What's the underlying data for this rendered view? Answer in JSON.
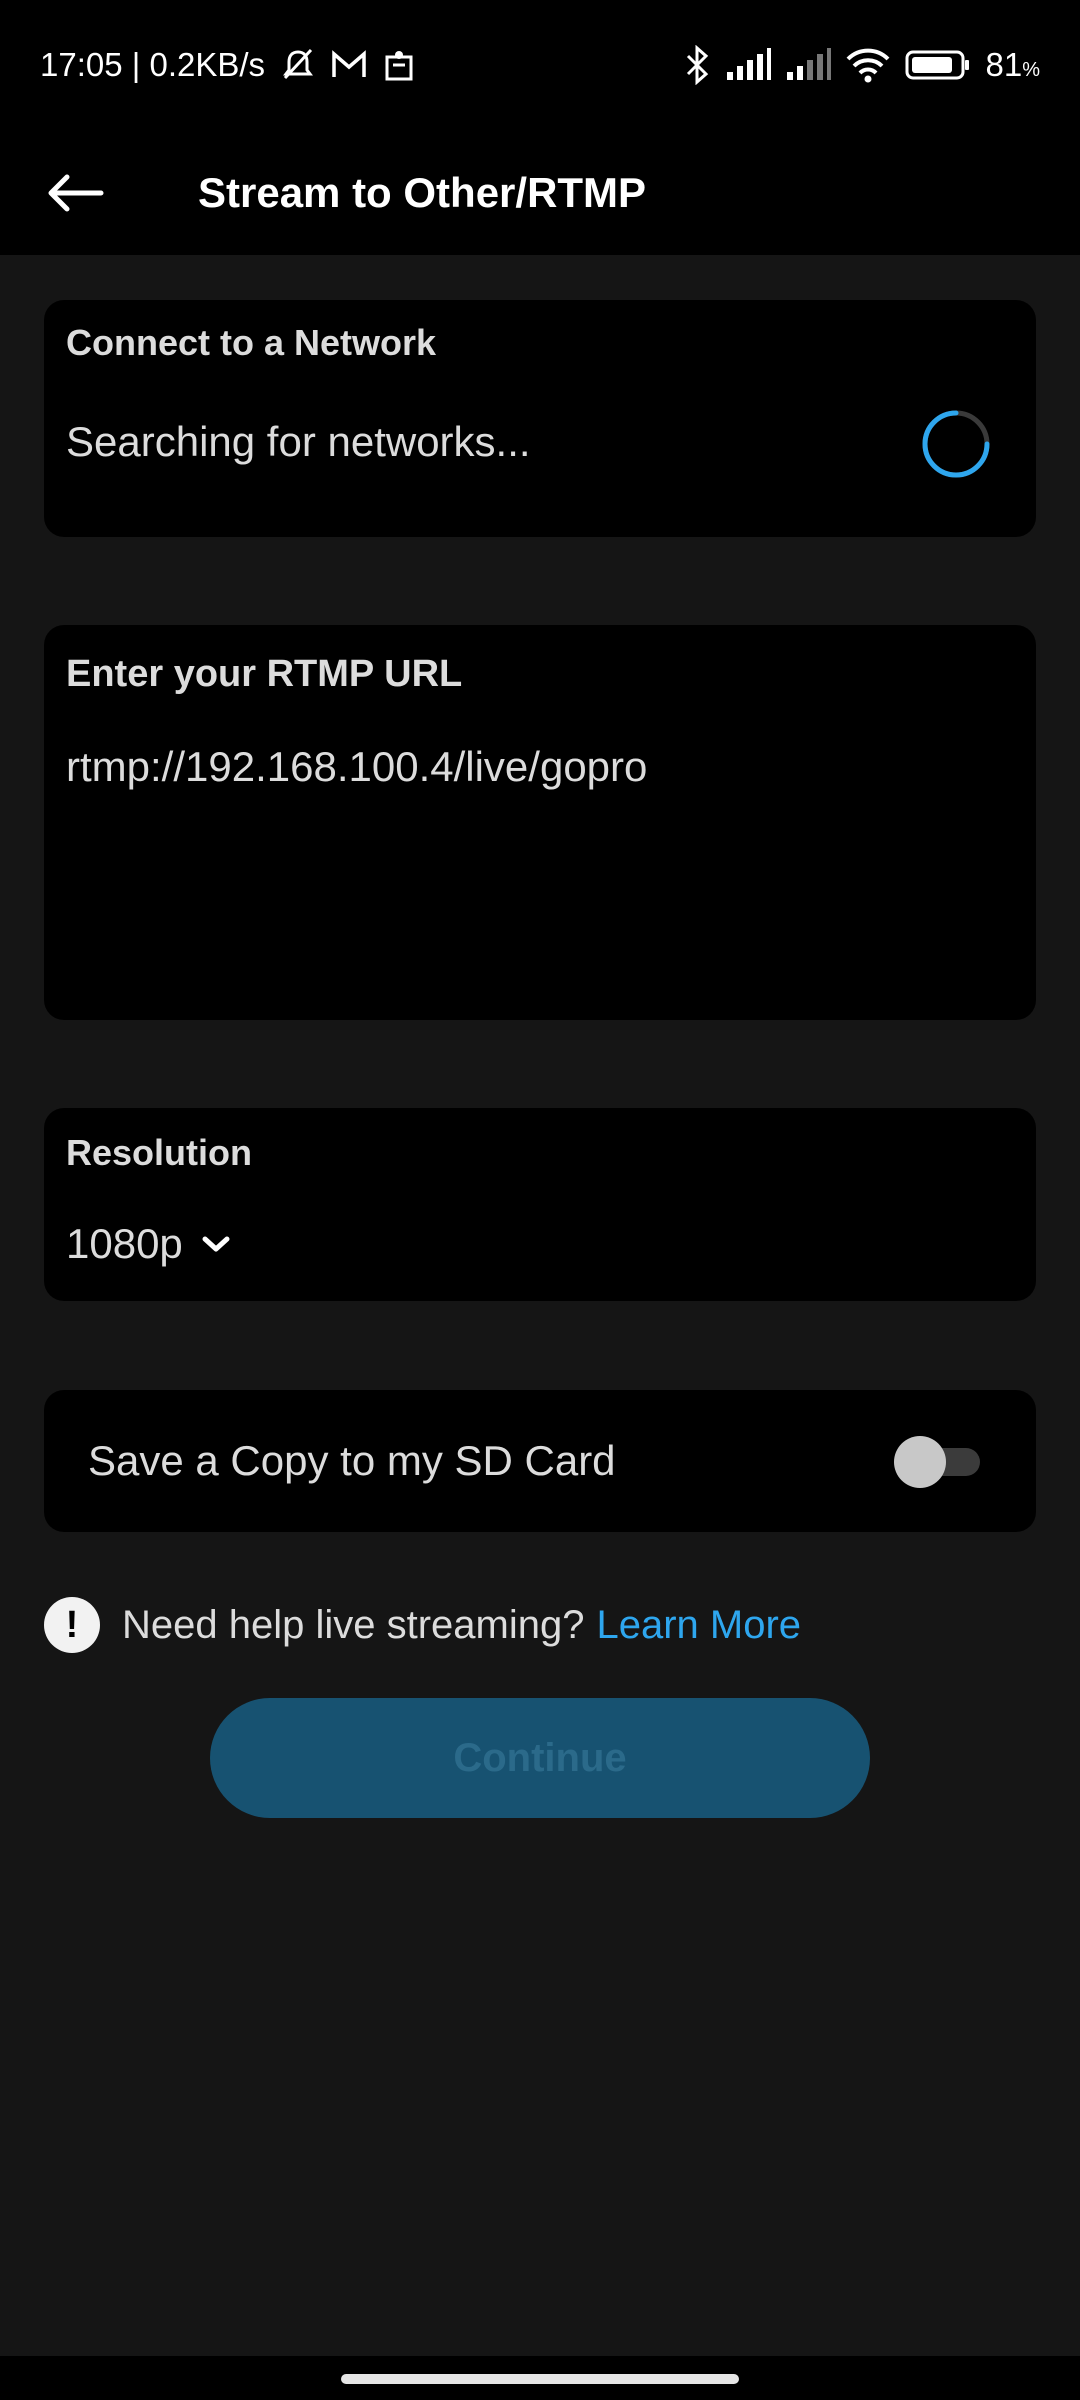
{
  "status_bar": {
    "time_speed": "17:05 | 0.2KB/s",
    "battery_percent": "81",
    "battery_unit": "%",
    "icons": [
      "mute-alarm-icon",
      "gmail-icon",
      "app-notification-icon",
      "bluetooth-icon",
      "signal-icon",
      "signal-icon",
      "wifi-icon",
      "battery-icon"
    ]
  },
  "header": {
    "title": "Stream to Other/RTMP"
  },
  "network": {
    "label": "Connect to a Network",
    "status": "Searching for networks..."
  },
  "rtmp": {
    "label": "Enter your RTMP URL",
    "value": "rtmp://192.168.100.4/live/gopro"
  },
  "resolution": {
    "label": "Resolution",
    "selected": "1080p"
  },
  "sd_copy": {
    "label": "Save a Copy to my SD Card",
    "enabled": false
  },
  "help": {
    "text": "Need help live streaming?",
    "link": "Learn More"
  },
  "continue_label": "Continue",
  "colors": {
    "accent": "#2ea6ee",
    "button_bg": "#175271",
    "card_bg": "#000000",
    "page_bg": "#151515"
  }
}
